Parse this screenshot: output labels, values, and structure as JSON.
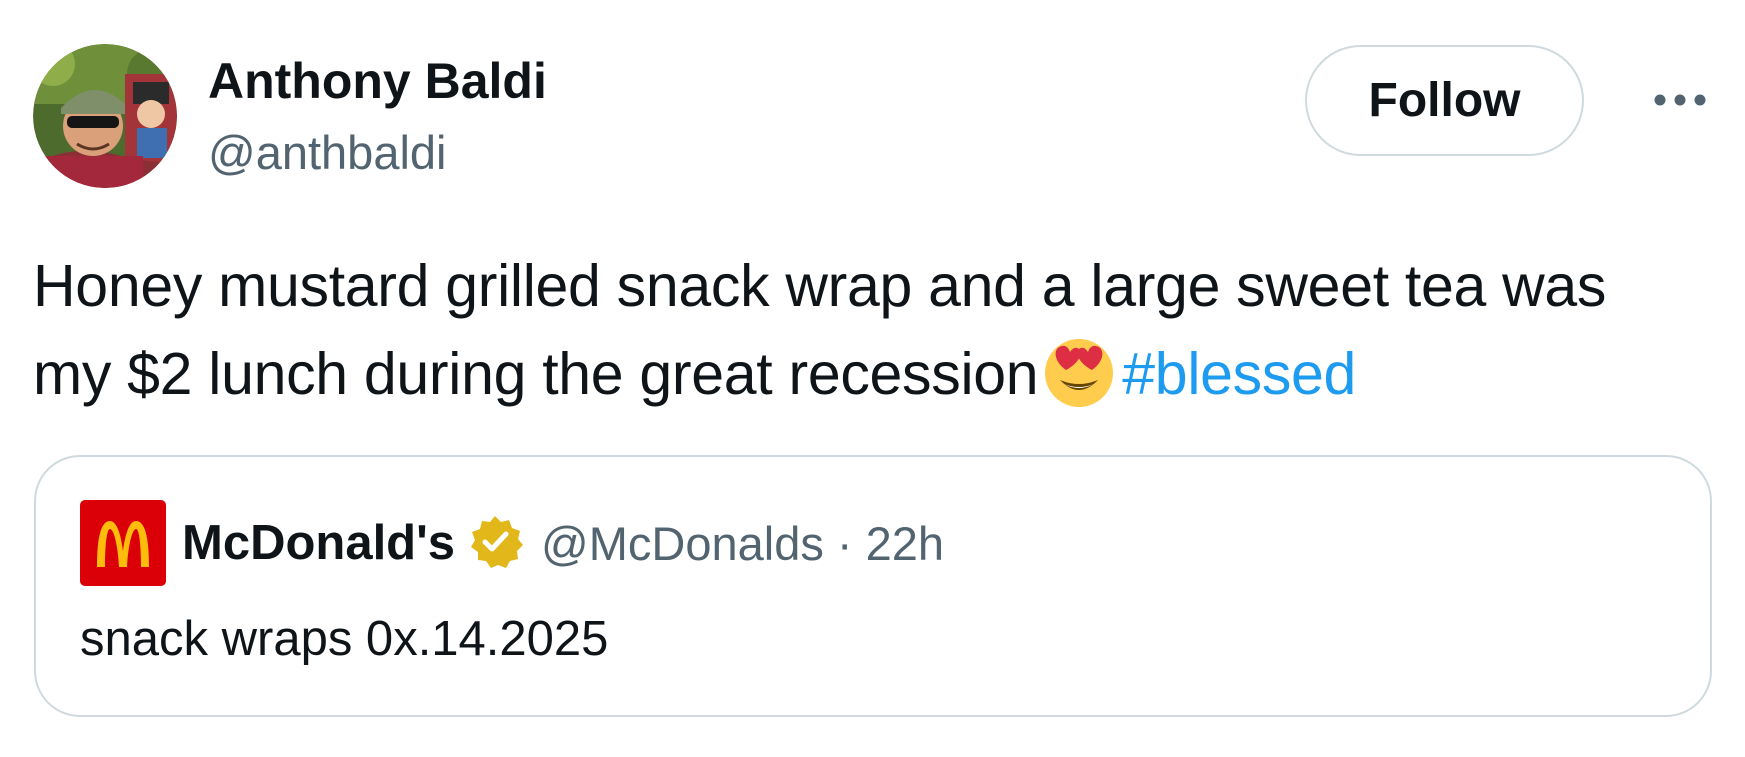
{
  "author": {
    "name": "Anthony Baldi",
    "handle": "@anthbaldi"
  },
  "actions": {
    "follow_label": "Follow",
    "more_icon": "more-horizontal-icon"
  },
  "tweet": {
    "text_line1": "Honey mustard grilled snack wrap and a large sweet tea was",
    "text_line2": "my $2 lunch during the great recession",
    "emoji": "smiling-face-with-heart-eyes",
    "hashtag": "#blessed"
  },
  "quoted": {
    "name": "McDonald's",
    "verified_icon": "gold-verified-badge-icon",
    "handle": "@McDonalds",
    "separator": "·",
    "time": "22h",
    "text": "snack wraps 0x.14.2025"
  },
  "colors": {
    "link": "#1d9bf0",
    "secondary_text": "#536471",
    "border": "#cfd9de",
    "mcdonalds_red": "#db0007",
    "mcdonalds_yellow": "#ffbc0d",
    "verified_gold": "#e2b719"
  }
}
